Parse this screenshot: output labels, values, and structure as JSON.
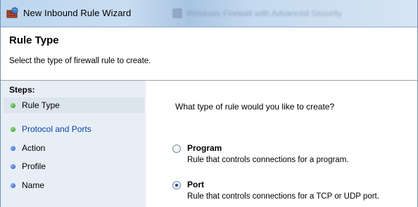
{
  "window": {
    "title": "New Inbound Rule Wizard",
    "background_window_title": "Windows Firewall with Advanced Security"
  },
  "header": {
    "title": "Rule Type",
    "subtitle": "Select the type of firewall rule to create."
  },
  "steps": {
    "heading": "Steps:",
    "items": [
      {
        "label": "Rule Type",
        "status": "current",
        "dot": "green-dot-icon"
      },
      {
        "label": "Protocol and Ports",
        "status": "link",
        "dot": "green-dot-icon"
      },
      {
        "label": "Action",
        "status": "pending",
        "dot": "blue-dot-icon"
      },
      {
        "label": "Profile",
        "status": "pending",
        "dot": "blue-dot-icon"
      },
      {
        "label": "Name",
        "status": "pending",
        "dot": "blue-dot-icon"
      }
    ]
  },
  "main": {
    "question": "What type of rule would you like to create?",
    "options": [
      {
        "label": "Program",
        "description": "Rule that controls connections for a program.",
        "selected": false
      },
      {
        "label": "Port",
        "description": "Rule that controls connections for a TCP or UDP port.",
        "selected": true
      }
    ]
  },
  "colors": {
    "link": "#0645ad",
    "steps_background": "#e8eef5",
    "titlebar": "#bcd6ee"
  }
}
